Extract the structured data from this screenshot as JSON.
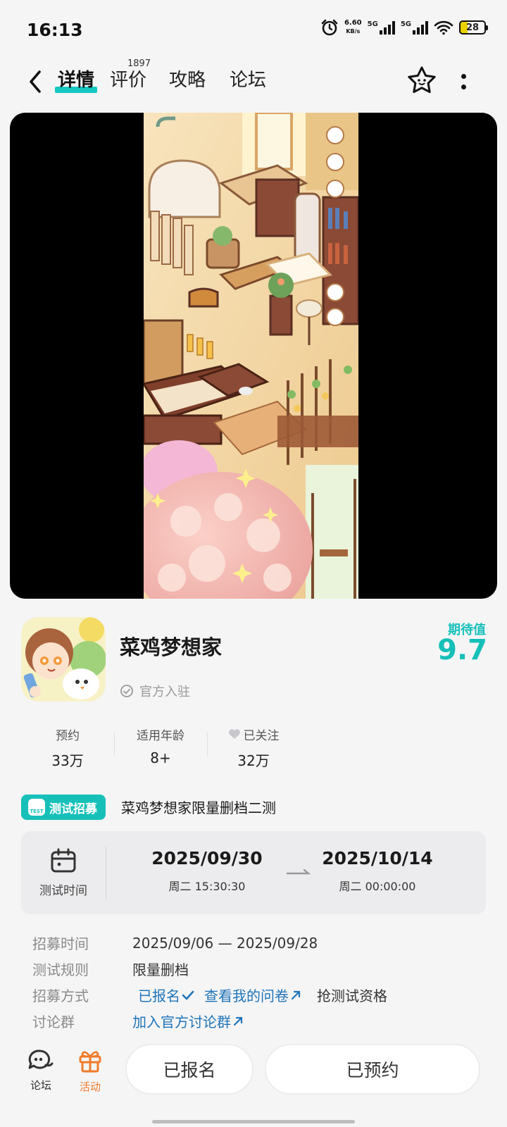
{
  "status_bar": {
    "time": "16:13",
    "net_speed_value": "6.60",
    "net_speed_unit": "KB/s",
    "sim1": "5G",
    "sim2": "5G",
    "battery": "28"
  },
  "nav": {
    "tabs": [
      {
        "label": "详情",
        "active": true
      },
      {
        "label": "评价",
        "badge": "1897"
      },
      {
        "label": "攻略"
      },
      {
        "label": "论坛"
      }
    ]
  },
  "app": {
    "name": "菜鸡梦想家",
    "official_label": "官方入驻",
    "expectation_label": "期待值",
    "expectation_value": "9.7"
  },
  "stats": [
    {
      "label": "预约",
      "value": "33万"
    },
    {
      "label": "适用年龄",
      "value": "8+"
    },
    {
      "label": "已关注",
      "value": "32万"
    }
  ],
  "test": {
    "badge_icon_text": "TEST",
    "badge_label": "测试招募",
    "title": "菜鸡梦想家限量删档二测",
    "time_label": "测试时间",
    "start_date": "2025/09/30",
    "start_time": "周二  15:30:30",
    "end_date": "2025/10/14",
    "end_time": "周二  00:00:00"
  },
  "info": {
    "recruit_time_label": "招募时间",
    "recruit_time_value": "2025/09/06 — 2025/09/28",
    "rule_label": "测试规则",
    "rule_value": "限量删档",
    "method_label": "招募方式",
    "method_registered": "已报名",
    "method_questionnaire": "查看我的问卷",
    "method_grab": "抢测试资格",
    "group_label": "讨论群",
    "group_link": "加入官方讨论群"
  },
  "bottom": {
    "forum_label": "论坛",
    "activity_label": "活动",
    "registered_button": "已报名",
    "reserved_button": "已预约"
  },
  "colors": {
    "accent": "#16c0b9",
    "link": "#1f74b8",
    "activity": "#f07b2a"
  }
}
